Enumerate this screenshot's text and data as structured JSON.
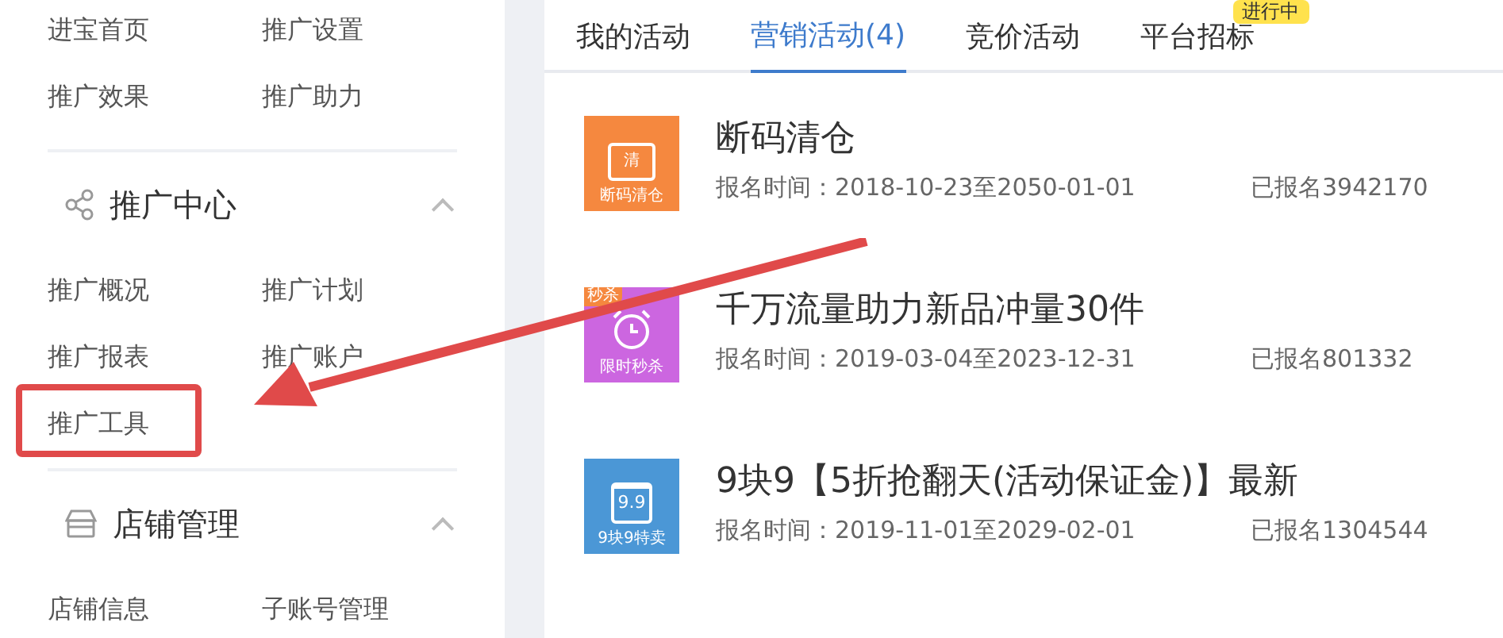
{
  "sidebar": {
    "sections": [
      {
        "items": [
          "进宝首页",
          "推广设置",
          "推广效果",
          "推广助力"
        ]
      },
      {
        "title": "推广中心",
        "expanded": true,
        "items": [
          "推广概况",
          "推广计划",
          "推广报表",
          "推广账户",
          "推广工具"
        ]
      },
      {
        "title": "店铺管理",
        "expanded": true,
        "items": [
          "店铺信息",
          "子账号管理"
        ]
      }
    ]
  },
  "tabs": [
    {
      "label": "我的活动",
      "selected": false
    },
    {
      "label": "营销活动(4)",
      "selected": true
    },
    {
      "label": "竞价活动",
      "selected": false
    },
    {
      "label": "平台招标",
      "selected": false,
      "badge": "进行中"
    }
  ],
  "activities": [
    {
      "title": "断码清仓",
      "icon_label": "断码清仓",
      "glyph_text": "清",
      "color": "#f5883f",
      "signup_time": "报名时间：2018-10-23至2050-01-01",
      "signed_up": "已报名3942170"
    },
    {
      "title": "千万流量助力新品冲量30件",
      "icon_label": "限时秒杀",
      "tag": "秒杀",
      "color": "#cc66e0",
      "signup_time": "报名时间：2019-03-04至2023-12-31",
      "signed_up": "已报名801332"
    },
    {
      "title": "9块9【5折抢翻天(活动保证金)】最新",
      "icon_label": "9块9特卖",
      "glyph_text": "9.9",
      "color": "#4b97d6",
      "signup_time": "报名时间：2019-11-01至2029-02-01",
      "signed_up": "已报名1304544"
    }
  ]
}
